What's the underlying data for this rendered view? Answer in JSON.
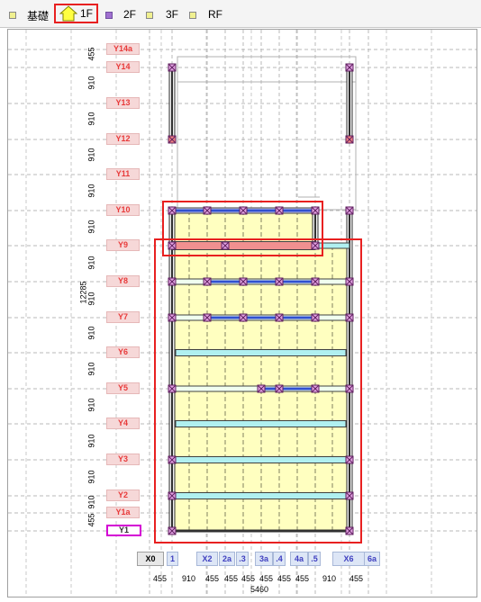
{
  "tabs": [
    {
      "label": "基礎",
      "square": "#f0f090"
    },
    {
      "label": "1F",
      "square": "#f0f000",
      "icon": "house-icon",
      "active": true
    },
    {
      "label": "2F",
      "square": "#a070d0"
    },
    {
      "label": "3F",
      "square": "#f0f090"
    },
    {
      "label": "RF",
      "square": "#f0f090"
    }
  ],
  "row_labels": [
    "Y14a",
    "Y14",
    "Y13",
    "Y12",
    "Y11",
    "Y10",
    "Y9",
    "Y8",
    "Y7",
    "Y6",
    "Y5",
    "Y4",
    "Y3",
    "Y2",
    "Y1a",
    "Y1"
  ],
  "row_dims": [
    "455",
    "910",
    "910",
    "910",
    "910",
    "910",
    "910",
    "910",
    "910",
    "910",
    "910",
    "910",
    "910",
    "910",
    "455",
    "455"
  ],
  "total_vertical": "12285",
  "col_labels": [
    "X0",
    "1",
    "X2",
    "2a",
    ".3",
    "3a",
    ".4",
    "4a",
    ".5",
    "X6",
    "6a"
  ],
  "col_dims": [
    "455",
    "910",
    "455",
    "455",
    "455",
    "455",
    "455",
    "455",
    "910",
    "455"
  ],
  "total_horizontal": "5460",
  "colors": {
    "floor": "#ffffc0",
    "beam": "#b0f0f0",
    "beam_blue": "#3050d0",
    "beam_red": "#f09090",
    "highlight": "#e82020",
    "selected_label": "#d400d4"
  }
}
